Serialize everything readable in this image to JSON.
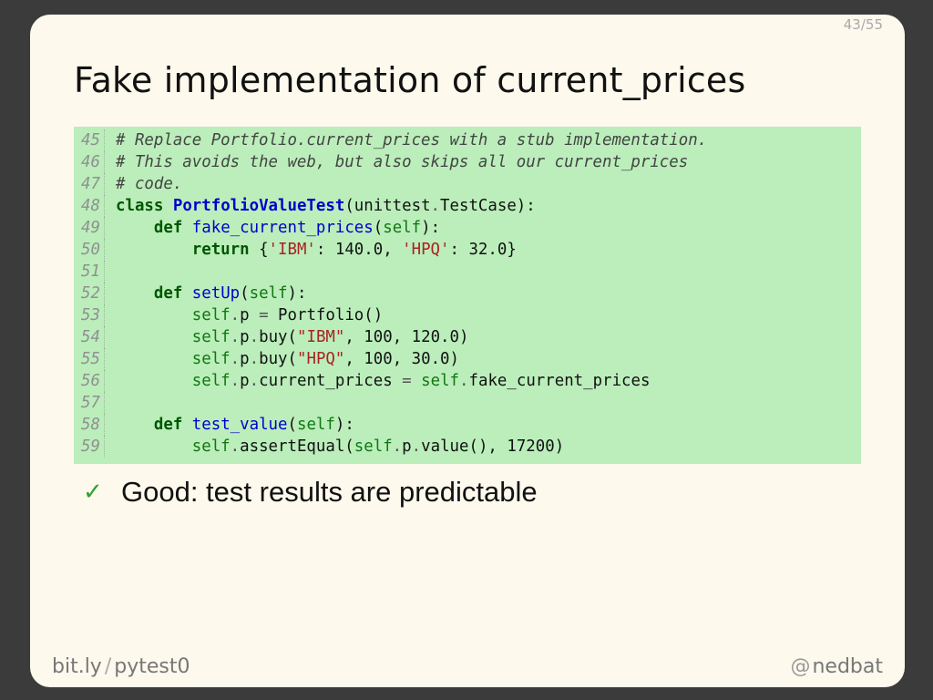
{
  "slide": {
    "page_counter": "43/55",
    "title": "Fake implementation of current_prices"
  },
  "code": {
    "line_numbers": [
      "45",
      "46",
      "47",
      "48",
      "49",
      "50",
      "51",
      "52",
      "53",
      "54",
      "55",
      "56",
      "57",
      "58",
      "59"
    ],
    "l45": "# Replace Portfolio.current_prices with a stub implementation.",
    "l46": "# This avoids the web, but also skips all our current_prices",
    "l47": "# code.",
    "l48": {
      "kw": "class",
      "name": "PortfolioValueTest",
      "rest": "(unittest",
      "dot": ".",
      "rest2": "TestCase):"
    },
    "l49": {
      "indent": "    ",
      "kw": "def",
      "name": "fake_current_prices",
      "open": "(",
      "self": "self",
      "close": "):"
    },
    "l50": {
      "indent": "        ",
      "kw": "return",
      "p1": " {",
      "s1": "'IBM'",
      "p2": ": 140.0, ",
      "s2": "'HPQ'",
      "p3": ": 32.0}"
    },
    "l52": {
      "indent": "    ",
      "kw": "def",
      "name": "setUp",
      "open": "(",
      "self": "self",
      "close": "):"
    },
    "l53": {
      "indent": "        ",
      "self": "self",
      "dot": ".",
      "rest": "p ",
      "op": "=",
      "rest2": " Portfolio()"
    },
    "l54": {
      "indent": "        ",
      "self": "self",
      "dot": ".",
      "rest": "p",
      "dot2": ".",
      "rest2": "buy(",
      "s": "\"IBM\"",
      "rest3": ", 100, 120.0)"
    },
    "l55": {
      "indent": "        ",
      "self": "self",
      "dot": ".",
      "rest": "p",
      "dot2": ".",
      "rest2": "buy(",
      "s": "\"HPQ\"",
      "rest3": ", 100, 30.0)"
    },
    "l56": {
      "indent": "        ",
      "self": "self",
      "dot": ".",
      "rest": "p",
      "dot2": ".",
      "rest2": "current_prices ",
      "op": "=",
      "sp": " ",
      "self2": "self",
      "dot3": ".",
      "rest3": "fake_current_prices"
    },
    "l58": {
      "indent": "    ",
      "kw": "def",
      "name": "test_value",
      "open": "(",
      "self": "self",
      "close": "):"
    },
    "l59": {
      "indent": "        ",
      "self": "self",
      "dot": ".",
      "rest": "assertEqual(",
      "self2": "self",
      "dot2": ".",
      "rest2": "p",
      "dot3": ".",
      "rest3": "value(), 17200)"
    }
  },
  "bullet": {
    "icon": "check-icon",
    "glyph": "✓",
    "text": "Good: test results are predictable",
    "icon_color": "#2ea12e"
  },
  "footer": {
    "left_site": "bit.ly",
    "left_sep": "/",
    "left_path": "pytest0",
    "right_at": "@",
    "right_handle": "nedbat"
  }
}
